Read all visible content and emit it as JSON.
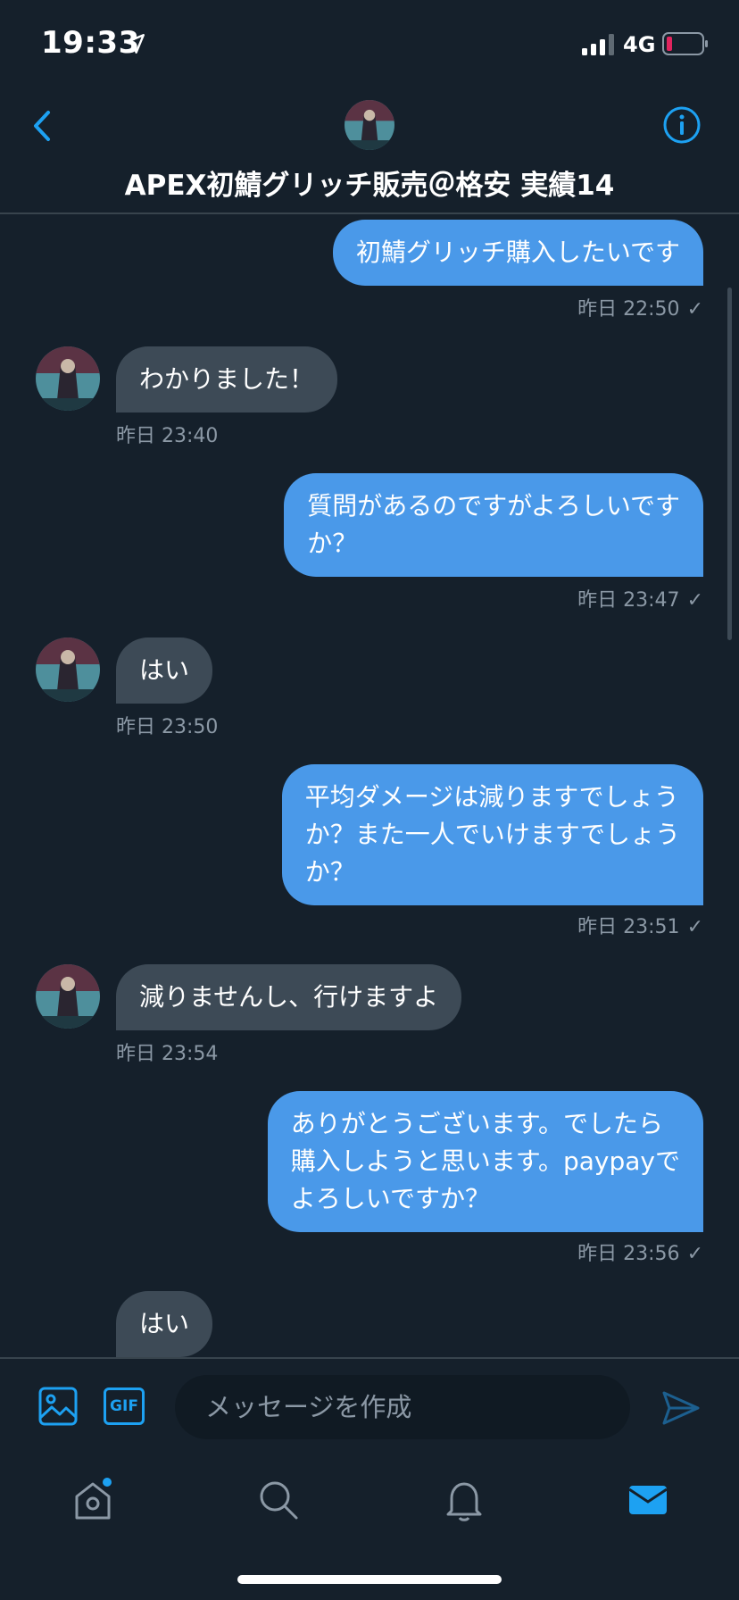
{
  "status_bar": {
    "time": "19:33",
    "network": "4G",
    "icons": [
      "location-arrow-icon",
      "signal-bars-icon",
      "battery-low-icon"
    ]
  },
  "header": {
    "title": "APEX初鯖グリッチ販売＠格安 実績14",
    "icons": [
      "back-arrow-icon",
      "avatar",
      "info-icon"
    ]
  },
  "messages": [
    {
      "side": "sent",
      "text": "初鯖グリッチ購入したいです",
      "time": "昨日 22:50",
      "check": "✓"
    },
    {
      "side": "received",
      "text": "わかりました！",
      "time": "昨日 23:40"
    },
    {
      "side": "sent",
      "lines": [
        "質問があるのですがよろしいです",
        "か？"
      ],
      "time": "昨日 23:47",
      "check": "✓"
    },
    {
      "side": "received",
      "text": "はい",
      "time": "昨日 23:50"
    },
    {
      "side": "sent",
      "lines": [
        "平均ダメージは減りますでしょう",
        "か？また一人でいけますでしょう",
        "か？"
      ],
      "time": "昨日 23:51",
      "check": "✓"
    },
    {
      "side": "received",
      "text": "減りませんし、行けますよ",
      "time": "昨日 23:54"
    },
    {
      "side": "sent",
      "lines": [
        "ありがとうございます。でしたら",
        "購入しようと思います。paypayで",
        "よろしいですか？"
      ],
      "time": "昨日 23:56",
      "check": "✓"
    },
    {
      "side": "received",
      "text": "はい"
    }
  ],
  "composer": {
    "placeholder": "メッセージを作成",
    "gif_label": "GIF",
    "icons": [
      "image-icon",
      "gif-icon",
      "send-icon"
    ]
  },
  "tabbar": {
    "items": [
      "home-icon",
      "search-icon",
      "notifications-bell-icon",
      "messages-mail-icon"
    ],
    "active": "messages-mail-icon",
    "home_has_dot": true
  },
  "colors": {
    "background": "#15202b",
    "accent": "#1da1f2",
    "sent_bubble": "#4a99e9",
    "received_bubble": "#3d4a56",
    "muted_text": "#8b98a5",
    "battery_low": "#e0245e"
  }
}
